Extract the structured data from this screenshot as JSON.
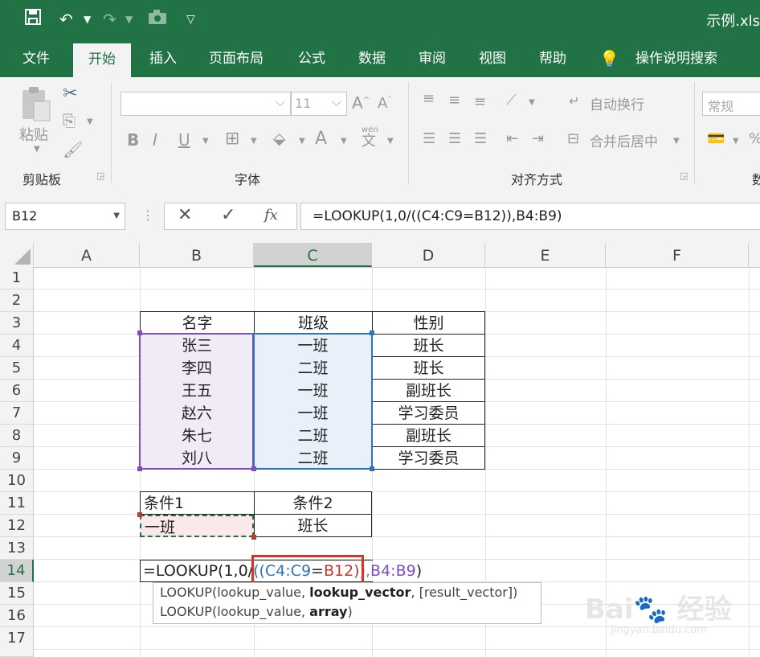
{
  "titlebar": {
    "doc_title": "示例.xls"
  },
  "tabs": [
    "文件",
    "开始",
    "插入",
    "页面布局",
    "公式",
    "数据",
    "审阅",
    "视图",
    "帮助"
  ],
  "tell_me": "操作说明搜索",
  "ribbon": {
    "clipboard": {
      "paste": "粘贴",
      "label": "剪贴板"
    },
    "font": {
      "size": "11",
      "bold": "B",
      "italic": "I",
      "underline": "U",
      "label": "字体",
      "wen": "wén",
      "wen_char": "文"
    },
    "alignment": {
      "wrap": "自动换行",
      "merge": "合并后居中",
      "label": "对齐方式"
    },
    "number": {
      "format": "常规",
      "label_partial": "数"
    }
  },
  "formula_bar": {
    "name_box": "B12",
    "formula": "=LOOKUP(1,0/((C4:C9=B12)),B4:B9)",
    "fx": "fx"
  },
  "columns": [
    "A",
    "B",
    "C",
    "D",
    "E",
    "F"
  ],
  "rows": [
    "1",
    "2",
    "3",
    "4",
    "5",
    "6",
    "7",
    "8",
    "9",
    "10",
    "11",
    "12",
    "13",
    "14",
    "15",
    "16",
    "17"
  ],
  "table": {
    "headers": [
      "名字",
      "班级",
      "性别"
    ],
    "rows": [
      [
        "张三",
        "一班",
        "班长"
      ],
      [
        "李四",
        "二班",
        "班长"
      ],
      [
        "王五",
        "一班",
        "副班长"
      ],
      [
        "赵六",
        "一班",
        "学习委员"
      ],
      [
        "朱七",
        "二班",
        "副班长"
      ],
      [
        "刘八",
        "二班",
        "学习委员"
      ]
    ]
  },
  "conditions": {
    "h1": "条件1",
    "h2": "条件2",
    "v1": "一班",
    "v2": "班长"
  },
  "edit_cell": {
    "part1": "=LOOKUP(1,0/",
    "part2": "((C4:C9",
    "part3": "=",
    "part4": "B12)",
    "part5": ")",
    "part6": ",",
    "part7": "B4:B9",
    "part8": ")"
  },
  "tooltip": {
    "line1_a": "LOOKUP(lookup_value, ",
    "line1_b": "lookup_vector",
    "line1_c": ", [result_vector])",
    "line2_a": "LOOKUP(lookup_value, ",
    "line2_b": "array",
    "line2_c": ")"
  },
  "colors": {
    "accent": "#217346",
    "range_purple": "#7b4fbf",
    "range_blue": "#2e75b6",
    "highlight_red": "#d9342b"
  }
}
